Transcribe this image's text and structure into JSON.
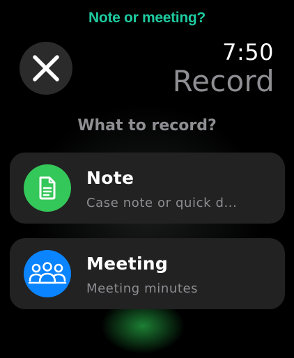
{
  "header": {
    "caption": "Note or meeting?",
    "time": "7:50",
    "title": "Record"
  },
  "close_button": {
    "icon": "close-icon"
  },
  "prompt": "What to record?",
  "options": [
    {
      "title": "Note",
      "subtitle": "Case note or quick d...",
      "icon": "document-icon",
      "color": "#34c759"
    },
    {
      "title": "Meeting",
      "subtitle": "Meeting minutes",
      "icon": "people-group-icon",
      "color": "#0a84ff"
    }
  ],
  "colors": {
    "caption": "#1ecba0",
    "card_background": "#222222",
    "secondary_text": "#8e8e93"
  }
}
